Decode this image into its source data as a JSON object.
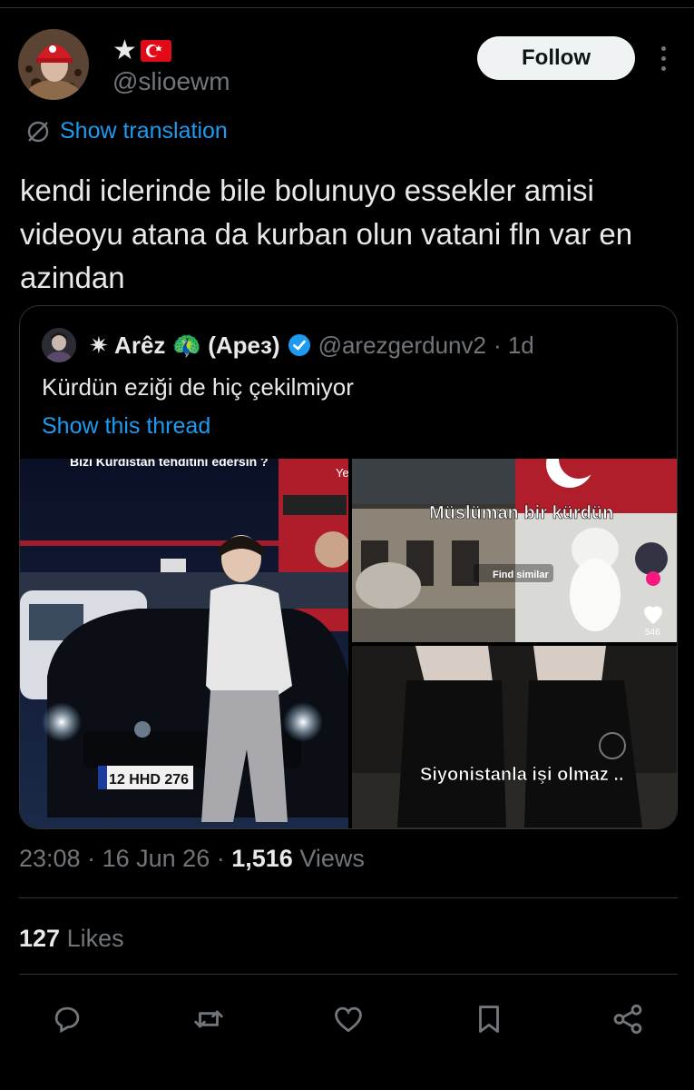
{
  "author": {
    "display_name": "★",
    "handle": "@slioewm",
    "flag_icon": "turkey-flag-icon"
  },
  "follow_label": "Follow",
  "show_translation": "Show translation",
  "tweet_text": "kendi iclerinde bile bolunuyo essekler amisi videoyu atana da kurban olun vatani fln var en azindan",
  "quote": {
    "display_name": "✷ Arêz 🦚 (Арез)",
    "handle": "@arezgerdunv2",
    "age": "· 1d",
    "text": "Kürdün eziği de hiç çekilmiyor",
    "show_thread": "Show this thread",
    "media": {
      "left_caption_top": "Bizi Kürdistan tehditini edersin ?",
      "license_plate": "12 HHD 276",
      "store_sign": "Ye",
      "top_right_caption": "Müslüman bir kürdün",
      "find_similar": "Find similar",
      "like_count": "546",
      "bottom_right_caption": "Siyonistanla işi olmaz .."
    }
  },
  "meta": {
    "time": "23:08",
    "date": "16 Jun 26",
    "views_count": "1,516",
    "views_label": "Views",
    "sep": "·"
  },
  "likes": {
    "count": "127",
    "label": "Likes"
  },
  "colors": {
    "accent": "#1d9bf0",
    "muted": "#71767b",
    "text": "#e7e9ea",
    "border": "#2f3336"
  }
}
